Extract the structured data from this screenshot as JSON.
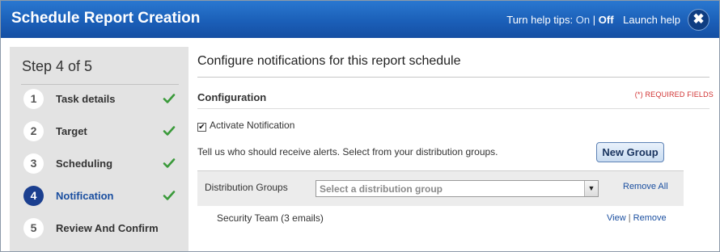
{
  "window": {
    "title": "Schedule Report Creation",
    "help_tips_label": "Turn help tips:",
    "help_on": "On",
    "help_separator": "|",
    "help_off": "Off",
    "launch_help": "Launch help",
    "close_glyph": "✖"
  },
  "sidebar": {
    "heading": "Step 4 of 5",
    "steps": [
      {
        "number": "1",
        "label": "Task details",
        "completed": true,
        "active": false
      },
      {
        "number": "2",
        "label": "Target",
        "completed": true,
        "active": false
      },
      {
        "number": "3",
        "label": "Scheduling",
        "completed": true,
        "active": false
      },
      {
        "number": "4",
        "label": "Notification",
        "completed": true,
        "active": true
      },
      {
        "number": "5",
        "label": "Review And Confirm",
        "completed": false,
        "active": false
      }
    ]
  },
  "main": {
    "title": "Configure notifications for this report schedule",
    "section_title": "Configuration",
    "required_note": "(*) REQUIRED FIELDS",
    "activate_label": "Activate Notification",
    "activate_checked": true,
    "instructions": "Tell us who should receive alerts. Select from your distribution groups.",
    "new_group_button": "New Group",
    "distribution": {
      "label": "Distribution Groups",
      "placeholder": "Select a distribution group",
      "remove_all": "Remove All"
    },
    "groups": [
      {
        "name": "Security Team (3 emails)",
        "view": "View",
        "separator": "|",
        "remove": "Remove"
      }
    ]
  },
  "colors": {
    "titlebar": "#1b5fb8",
    "active_step": "#1b3f8f",
    "link": "#1b4fa0",
    "check": "#3a9a3a",
    "required": "#d03030"
  }
}
